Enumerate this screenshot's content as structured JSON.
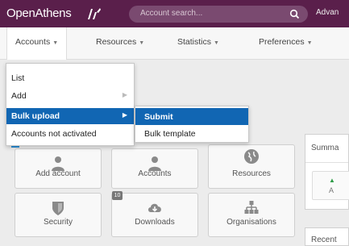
{
  "header": {
    "logo_text": "OpenAthens",
    "search_placeholder": "Account search...",
    "advanced_label": "Advan"
  },
  "nav": {
    "items": [
      {
        "label": "Accounts"
      },
      {
        "label": "Resources"
      },
      {
        "label": "Statistics"
      },
      {
        "label": "Preferences"
      }
    ]
  },
  "accounts_menu": {
    "items": [
      {
        "label": "List"
      },
      {
        "label": "Add"
      },
      {
        "label": "Bulk upload"
      },
      {
        "label": "Accounts not activated"
      }
    ],
    "highlighted_index": 2
  },
  "bulk_upload_submenu": {
    "items": [
      {
        "label": "Submit"
      },
      {
        "label": "Bulk template"
      }
    ],
    "highlighted_index": 0
  },
  "tiles": [
    {
      "label": "Add account",
      "icon": "person-add-icon"
    },
    {
      "label": "Accounts",
      "icon": "person-icon"
    },
    {
      "label": "Resources",
      "icon": "globe-icon"
    },
    {
      "label": "Security",
      "icon": "shield-icon"
    },
    {
      "label": "Downloads",
      "icon": "cloud-download-icon"
    },
    {
      "label": "Organisations",
      "icon": "org-chart-icon"
    }
  ],
  "downloads_badge": "10",
  "summary": {
    "title": "Summa",
    "stat_letter": "A"
  },
  "recent": {
    "title": "Recent"
  },
  "colors": {
    "header_bg": "#5a1f4b",
    "highlight": "#1166b3",
    "up_arrow": "#2e9b47"
  }
}
